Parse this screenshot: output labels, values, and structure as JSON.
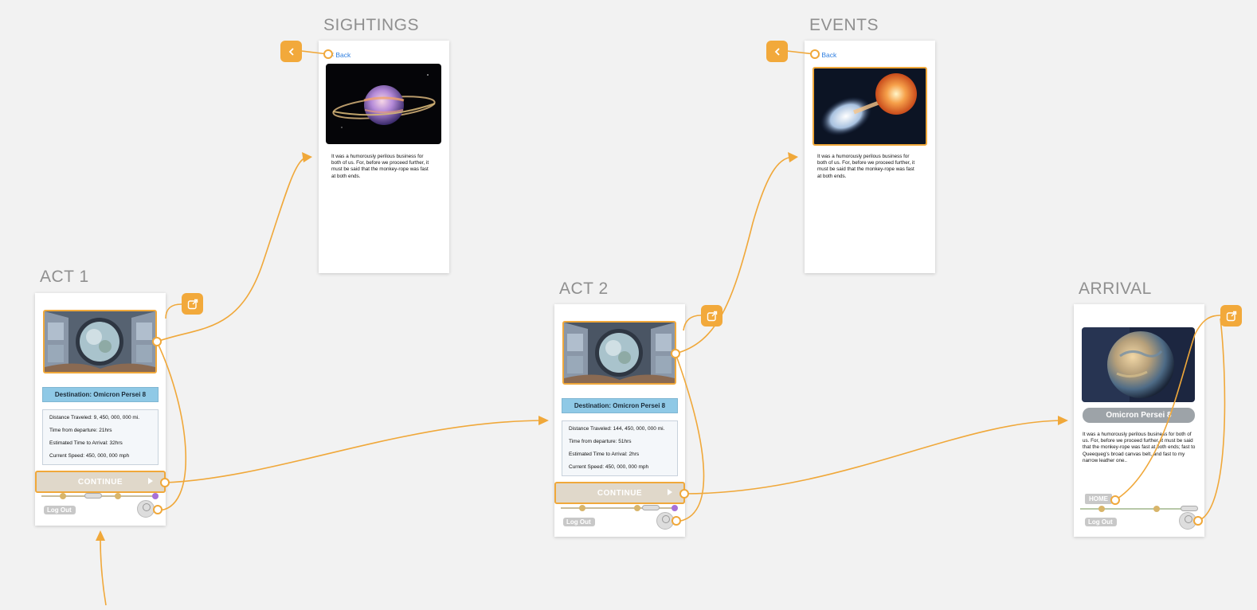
{
  "artboards": {
    "act1": {
      "title": "ACT 1"
    },
    "sightings": {
      "title": "SIGHTINGS"
    },
    "events": {
      "title": "EVENTS"
    },
    "act2": {
      "title": "ACT 2"
    },
    "arrival": {
      "title": "ARRIVAL"
    }
  },
  "act1": {
    "destination": "Destination: Omicron Persei 8",
    "stats": [
      "Distance Traveled: 9, 450, 000, 000 mi.",
      "Time from departure: 21hrs",
      "Estimated Time to Arrival: 32hrs",
      "Current Speed: 450, 000, 000 mph"
    ],
    "continue_label": "CONTINUE",
    "logout_label": "Log Out"
  },
  "act2": {
    "destination": "Destination: Omicron Persei 8",
    "stats": [
      "Distance Traveled: 144, 450, 000, 000 mi.",
      "Time from departure: 51hrs",
      "Estimated Time to Arrival: 2hrs",
      "Current Speed: 450, 000, 000 mph"
    ],
    "continue_label": "CONTINUE",
    "logout_label": "Log Out"
  },
  "sightings": {
    "back_label": "Back",
    "text": "It was a humorously perilous business for both of us. For, before we proceed further, it must be said that the monkey-rope was fast at both ends."
  },
  "events": {
    "back_label": "Back",
    "text": "It was a humorously perilous business for both of us. For, before we proceed further, it must be said that the monkey-rope was fast at both ends."
  },
  "arrival": {
    "planet_name": "Omicron Persei 8",
    "text": "It was a humorously perilous business for both of us. For, before we proceed further, it must be said that the monkey-rope was fast at both ends; fast to Queequeg's broad canvas belt, and fast to my narrow leather one..",
    "home_label": "HOME",
    "logout_label": "Log Out"
  },
  "colors": {
    "hotspot": "#f2a93b",
    "canvas": "#f2f2f2",
    "destination_bar": "#8fc9e6",
    "link": "#2f7fe0"
  },
  "icons": [
    "back-chevron-icon",
    "open-external-icon",
    "window-view-image",
    "ringed-planet-image",
    "star-collision-image",
    "arrival-planet-image",
    "avatar-icon",
    "spaceship-icon"
  ]
}
